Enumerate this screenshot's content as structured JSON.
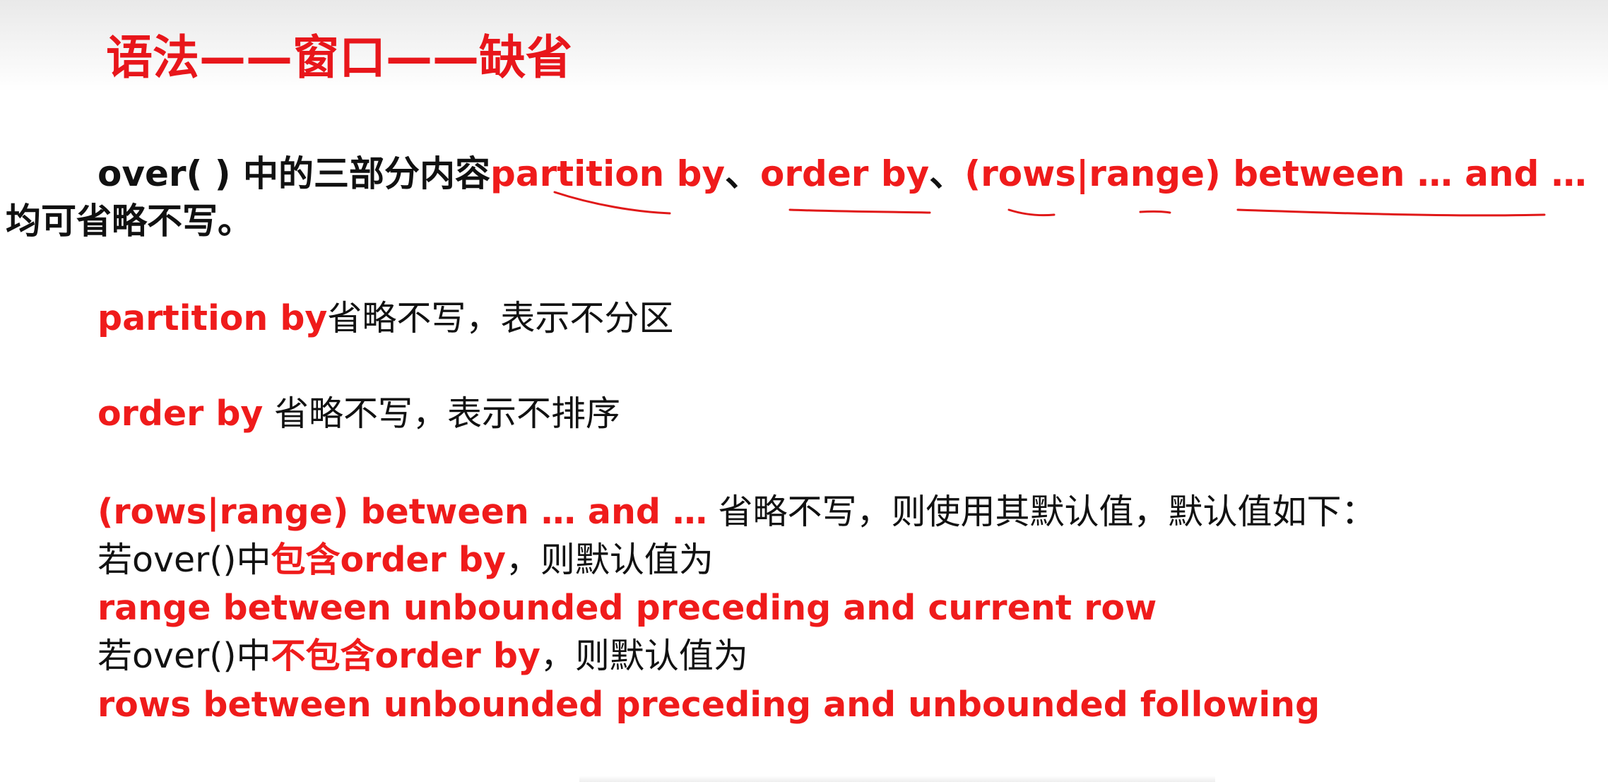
{
  "slide": {
    "title": "语法——窗口——缺省",
    "intro": {
      "prefix": "over( ) 中的三部分内容",
      "partition": "partition by",
      "sep1": "、",
      "order": "order by",
      "sep2": "、",
      "frame": "(rows|range) between … and …",
      "suffix": "均可省略不写。"
    },
    "partition_note": {
      "keyword": "partition by",
      "text": "省略不写，表示不分区"
    },
    "order_note": {
      "keyword": "order by",
      "text": " 省略不写，表示不排序"
    },
    "frame_note": {
      "keyword": "(rows|range) between … and …",
      "text": " 省略不写，则使用其默认值，默认值如下："
    },
    "case_with": {
      "prefix": "若over()中",
      "emph": "包含",
      "keyword": "order by",
      "suffix": "，则默认值为",
      "default": "range between unbounded preceding and current row"
    },
    "case_without": {
      "prefix": "若over()中",
      "emph": "不包含",
      "keyword": "order by",
      "suffix": "，则默认值为",
      "default": "rows between unbounded preceding and unbounded following"
    }
  },
  "colors": {
    "accent_red": "#ef1b1b",
    "title_red": "#e8161b",
    "text": "#111111"
  }
}
